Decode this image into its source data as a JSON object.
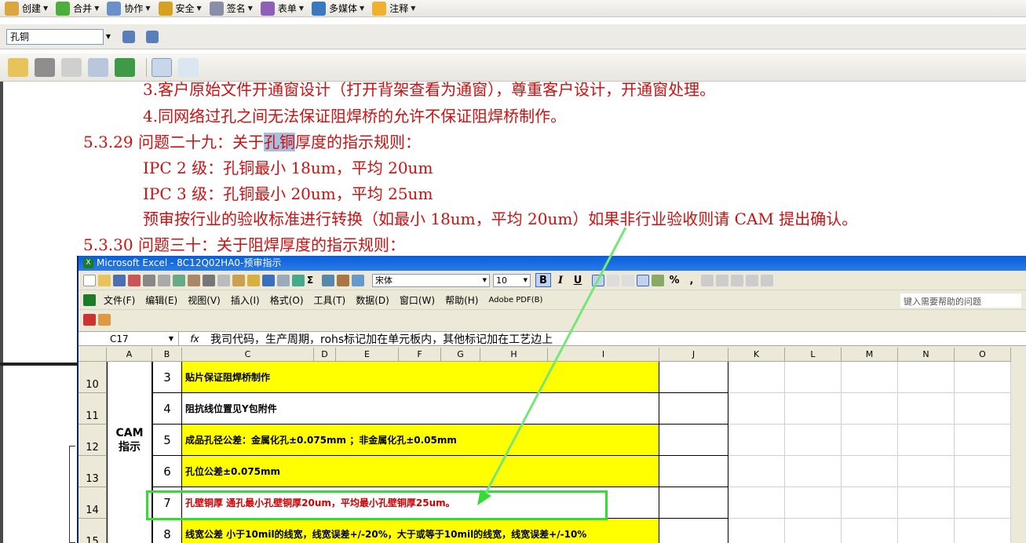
{
  "acrobat": {
    "toolbar1": [
      {
        "label": "创建",
        "icon": "create-icon"
      },
      {
        "label": "合并",
        "icon": "combine-icon"
      },
      {
        "label": "协作",
        "icon": "collaborate-icon"
      },
      {
        "label": "安全",
        "icon": "lock-icon"
      },
      {
        "label": "签名",
        "icon": "pen-icon"
      },
      {
        "label": "表单",
        "icon": "form-icon"
      },
      {
        "label": "多媒体",
        "icon": "multimedia-icon"
      },
      {
        "label": "注释",
        "icon": "comment-icon"
      }
    ],
    "search_value": "孔铜"
  },
  "doc_lines": {
    "l1": "3.客户原始文件开通窗设计（打开背架查看为通窗），尊重客户设计，开通窗处理。",
    "l2": "4.同网络过孔之间无法保证阻焊桥的允许不保证阻焊桥制作。",
    "l3_pre": "5.3.29 问题二十九：关于",
    "l3_hl": "孔铜",
    "l3_post": "厚度的指示规则：",
    "l4": "IPC 2 级：孔铜最小 18um，平均 20um",
    "l5": "IPC 3 级：孔铜最小 20um，平均 25um",
    "l6": "预审按行业的验收标准进行转换（如最小 18um，平均 20um）如果非行业验收则请 CAM 提出确认。",
    "l7": "5.3.30 问题三十：关于阻焊厚度的指示规则："
  },
  "excel": {
    "title": "Microsoft Excel - 8C12Q02HA0-预审指示",
    "font": "宋体",
    "size": "10",
    "bold": "B",
    "italic": "I",
    "underline": "U",
    "percent": "%",
    "comma": ",",
    "menus": [
      "文件(F)",
      "编辑(E)",
      "视图(V)",
      "插入(I)",
      "格式(O)",
      "工具(T)",
      "数据(D)",
      "窗口(W)",
      "帮助(H)",
      "Adobe PDF(B)"
    ],
    "help_placeholder": "键入需要帮助的问题",
    "namebox": "C17",
    "fx": "fx",
    "formula": "我司代码，生产周期，rohs标记加在单元板内，其他标记加在工艺边上",
    "columns": [
      "A",
      "B",
      "C",
      "D",
      "E",
      "F",
      "G",
      "H",
      "I",
      "J",
      "K",
      "L",
      "M",
      "N",
      "O"
    ],
    "group_label_1": "CAM",
    "group_label_2": "指示",
    "rows": [
      {
        "row": "10",
        "num": "3",
        "text": "贴片保证阻焊桥制作"
      },
      {
        "row": "11",
        "num": "4",
        "text": "阻抗线位置见Y包附件"
      },
      {
        "row": "12",
        "num": "5",
        "text": "成品孔径公差：金属化孔±0.075mm ；非金属化孔±0.05mm"
      },
      {
        "row": "13",
        "num": "6",
        "text": "孔位公差±0.075mm"
      },
      {
        "row": "14",
        "num": "7",
        "text": "孔壁铜厚  通孔最小孔壁铜厚20um，平均最小孔壁铜厚25um。"
      },
      {
        "row": "15",
        "num": "8",
        "text": "线宽公差  小于10mil的线宽，线宽误差+/-20%，大于或等于10mil的线宽，线宽误差+/-10%"
      }
    ]
  }
}
